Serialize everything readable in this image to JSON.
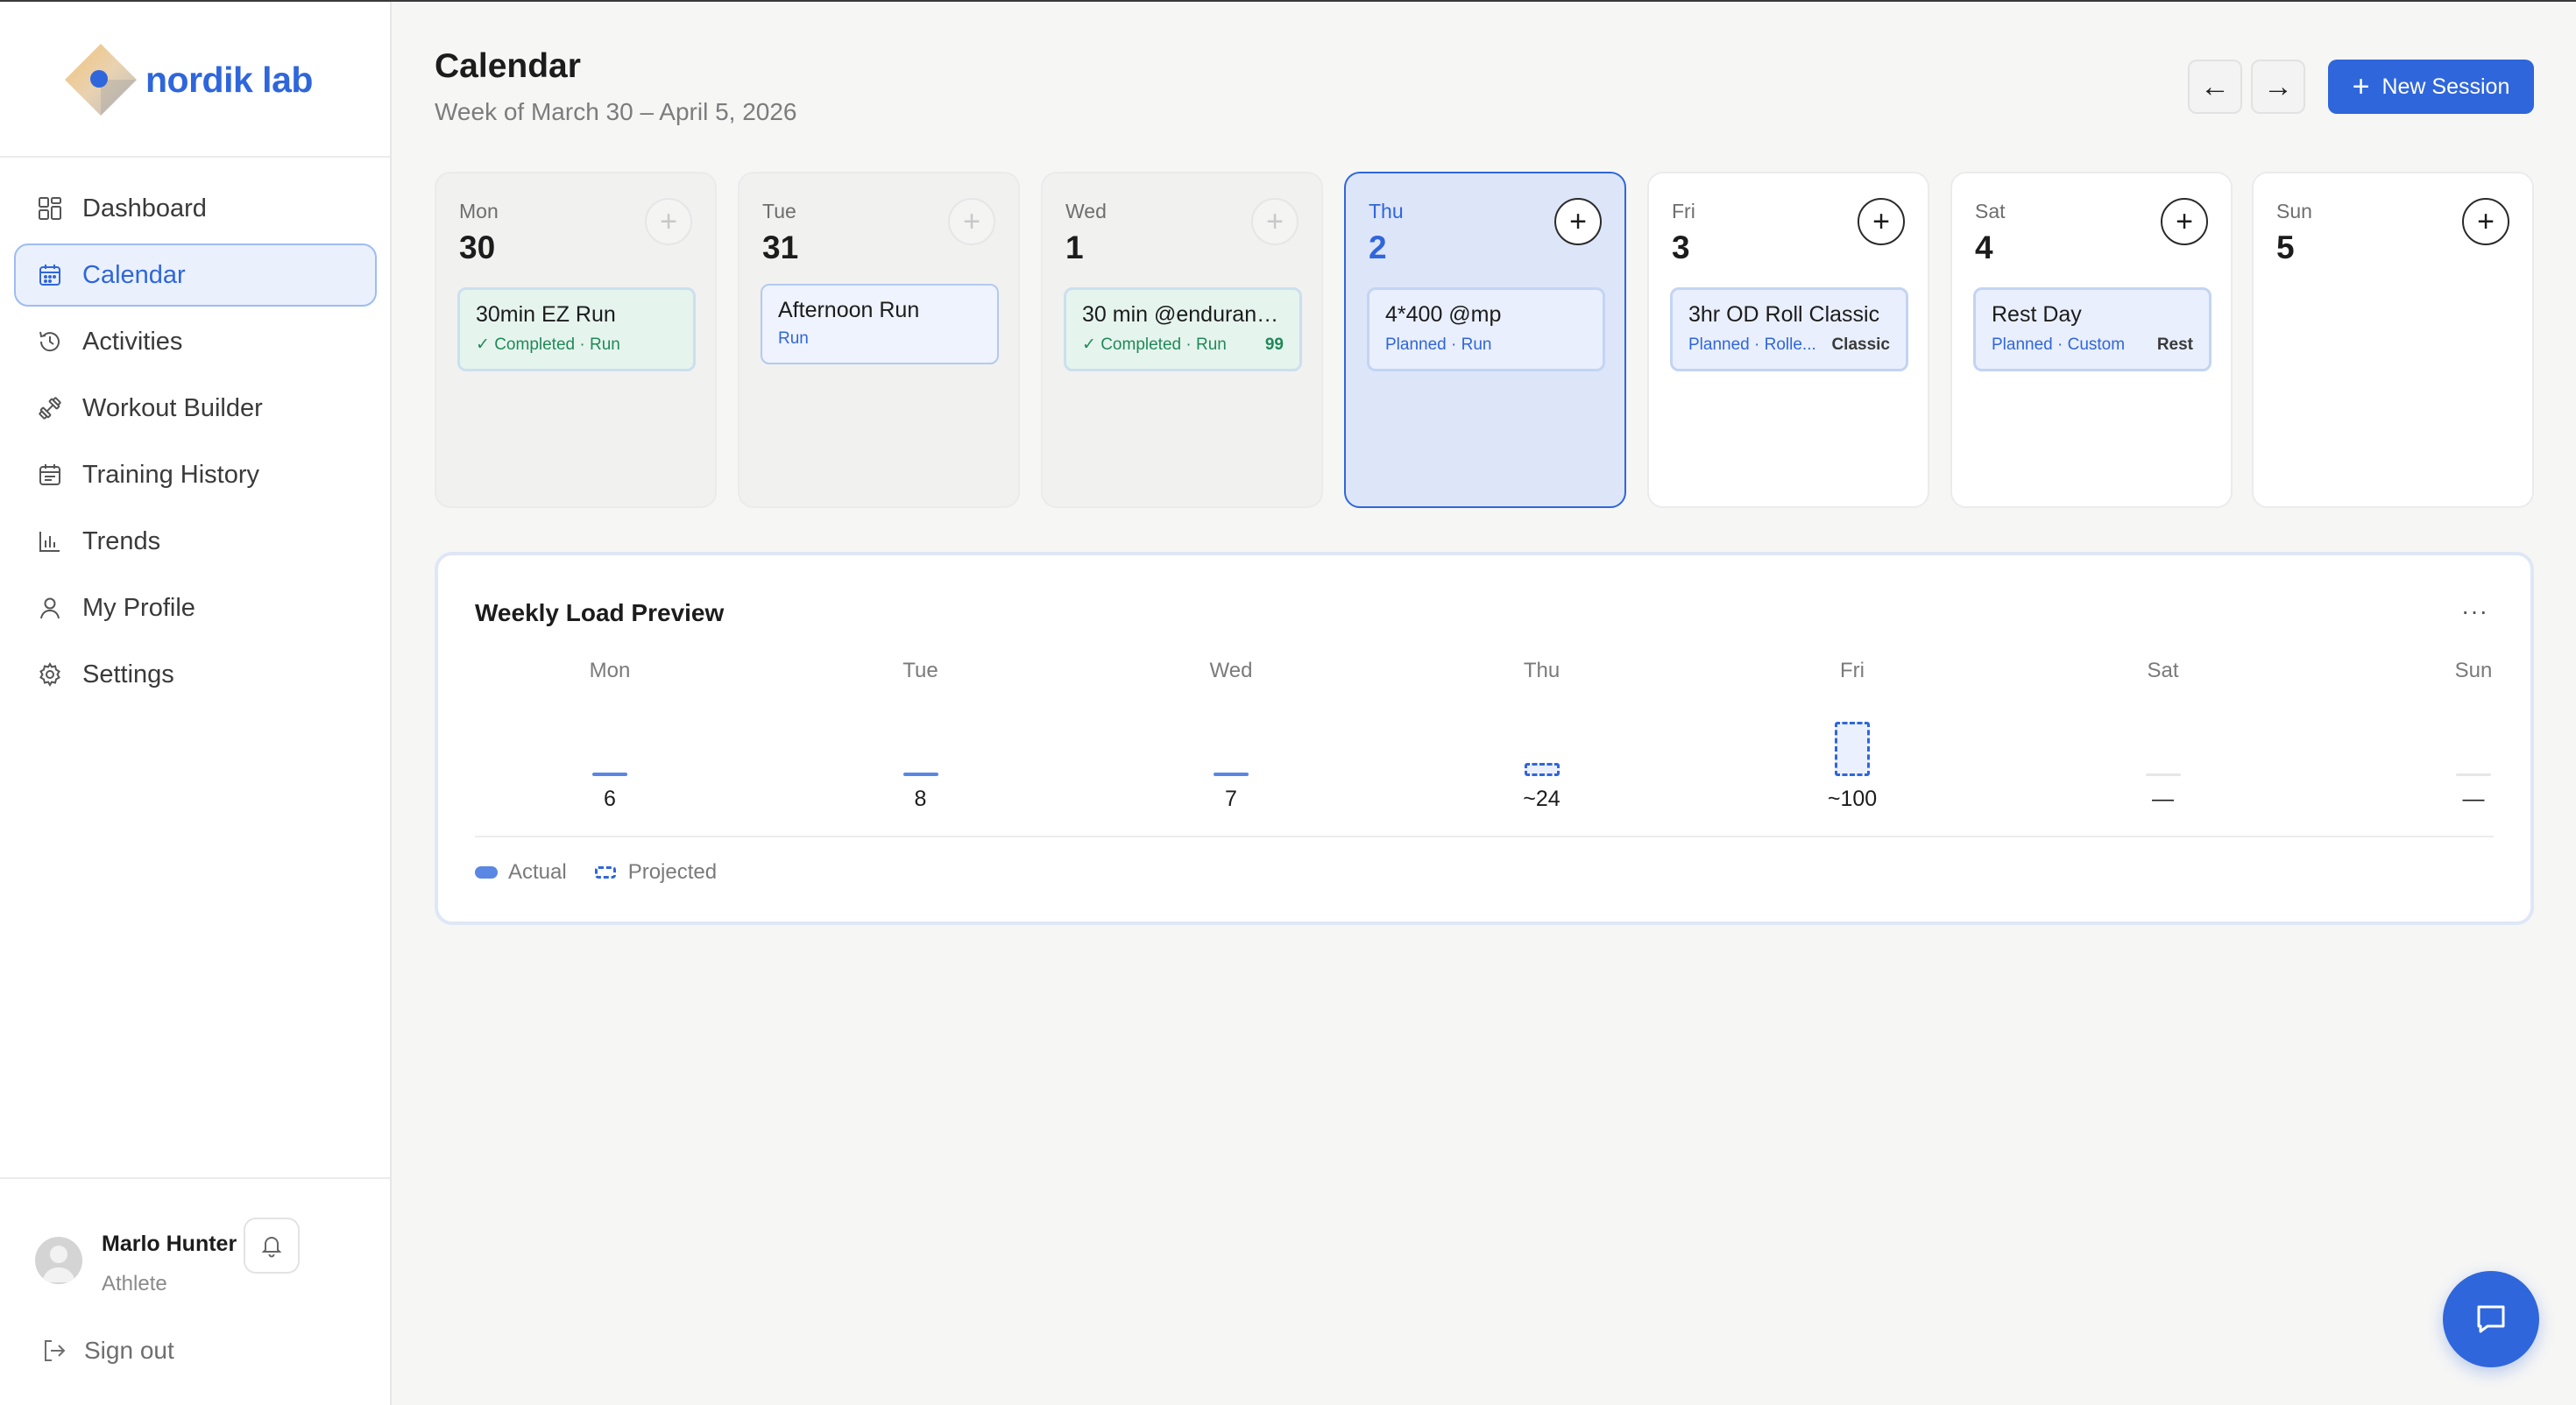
{
  "brand": {
    "name": "nordik lab",
    "accent": "#2f66db"
  },
  "nav": {
    "items": [
      {
        "label": "Dashboard",
        "icon": "grid-icon",
        "active": false
      },
      {
        "label": "Calendar",
        "icon": "calendar-icon",
        "active": true
      },
      {
        "label": "Activities",
        "icon": "history-icon",
        "active": false
      },
      {
        "label": "Workout Builder",
        "icon": "dumbbell-icon",
        "active": false
      },
      {
        "label": "Training History",
        "icon": "calendar-list-icon",
        "active": false
      },
      {
        "label": "Trends",
        "icon": "bar-chart-icon",
        "active": false
      },
      {
        "label": "My Profile",
        "icon": "user-icon",
        "active": false
      },
      {
        "label": "Settings",
        "icon": "gear-icon",
        "active": false
      }
    ]
  },
  "user": {
    "name": "Marlo Hunter",
    "role": "Athlete",
    "signout": "Sign out"
  },
  "header": {
    "title": "Calendar",
    "subtitle": "Week of March 30 – April 5, 2026",
    "prev": "←",
    "next": "→",
    "new_session": "New Session"
  },
  "days": [
    {
      "name": "Mon",
      "num": "30",
      "state": "past",
      "session": {
        "title": "30min EZ Run",
        "meta": "✓ Completed · Run",
        "right": "",
        "kind": "completed"
      }
    },
    {
      "name": "Tue",
      "num": "31",
      "state": "past",
      "session": {
        "title": "Afternoon Run",
        "meta": "Run",
        "right": "",
        "kind": "plain"
      }
    },
    {
      "name": "Wed",
      "num": "1",
      "state": "past",
      "session": {
        "title": "30 min @enduranc...",
        "meta": "✓ Completed · Run",
        "right": "99",
        "kind": "completed"
      }
    },
    {
      "name": "Thu",
      "num": "2",
      "state": "today",
      "session": {
        "title": "4*400 @mp",
        "meta": "Planned · Run",
        "right": "",
        "kind": "planned"
      }
    },
    {
      "name": "Fri",
      "num": "3",
      "state": "future",
      "session": {
        "title": "3hr OD Roll Classic",
        "meta": "Planned · Rolle...",
        "right": "Classic",
        "kind": "planned"
      }
    },
    {
      "name": "Sat",
      "num": "4",
      "state": "future",
      "session": {
        "title": "Rest Day",
        "meta": "Planned · Custom",
        "right": "Rest",
        "kind": "planned"
      }
    },
    {
      "name": "Sun",
      "num": "5",
      "state": "future",
      "session": null
    }
  ],
  "load": {
    "title": "Weekly Load Preview",
    "more": "···",
    "legend": {
      "actual": "Actual",
      "projected": "Projected"
    },
    "columns": [
      {
        "day": "Mon",
        "value": "6",
        "load": 6,
        "kind": "actual"
      },
      {
        "day": "Tue",
        "value": "8",
        "load": 8,
        "kind": "actual"
      },
      {
        "day": "Wed",
        "value": "7",
        "load": 7,
        "kind": "actual"
      },
      {
        "day": "Thu",
        "value": "~24",
        "load": 24,
        "kind": "projected"
      },
      {
        "day": "Fri",
        "value": "~100",
        "load": 100,
        "kind": "projected"
      },
      {
        "day": "Sat",
        "value": "—",
        "load": 0,
        "kind": "none"
      },
      {
        "day": "Sun",
        "value": "—",
        "load": 0,
        "kind": "none"
      }
    ]
  }
}
